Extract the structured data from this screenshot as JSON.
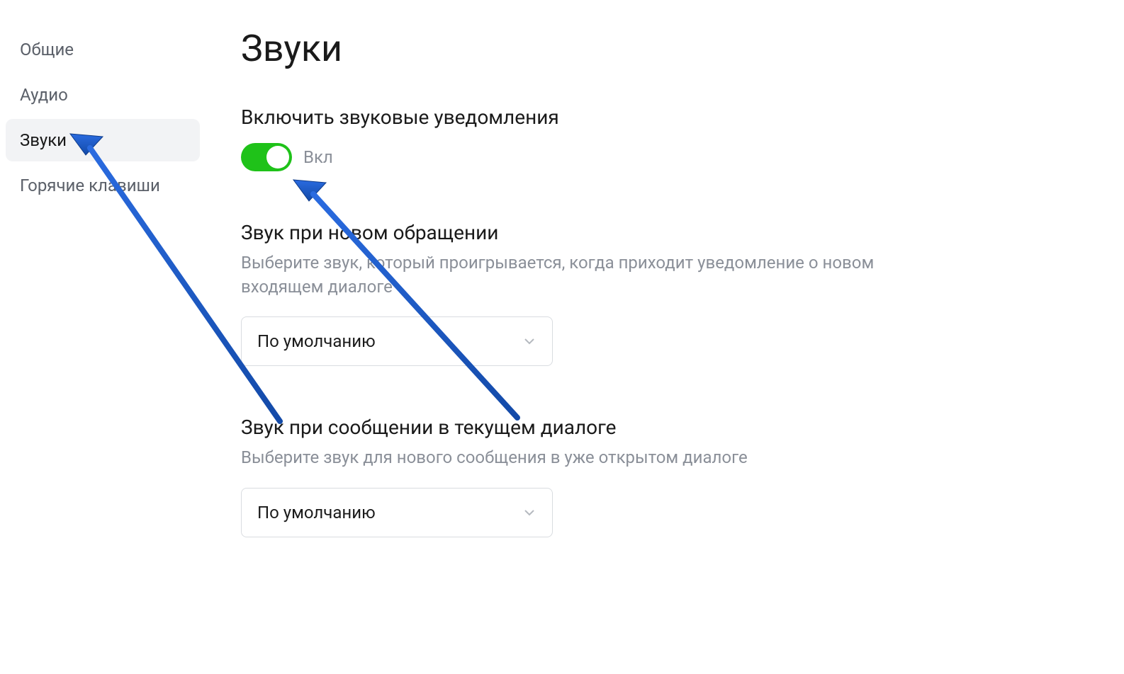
{
  "sidebar": {
    "items": [
      {
        "label": "Общие",
        "active": false
      },
      {
        "label": "Аудио",
        "active": false
      },
      {
        "label": "Звуки",
        "active": true
      },
      {
        "label": "Горячие клавиши",
        "active": false
      }
    ]
  },
  "page": {
    "title": "Звуки"
  },
  "sections": {
    "notifications": {
      "title": "Включить звуковые уведомления",
      "toggle_state": "Вкл"
    },
    "new_request": {
      "title": "Звук при новом обращении",
      "description": "Выберите звук, который проигрывается, когда приходит уведомление о новом входящем диалоге",
      "select_value": "По умолчанию"
    },
    "current_dialog": {
      "title": "Звук при сообщении в текущем диалоге",
      "description": "Выберите звук для нового сообщения в уже открытом диалоге",
      "select_value": "По умолчанию"
    }
  },
  "colors": {
    "toggle_on": "#1fc219",
    "arrow": "#1c5cc7"
  }
}
